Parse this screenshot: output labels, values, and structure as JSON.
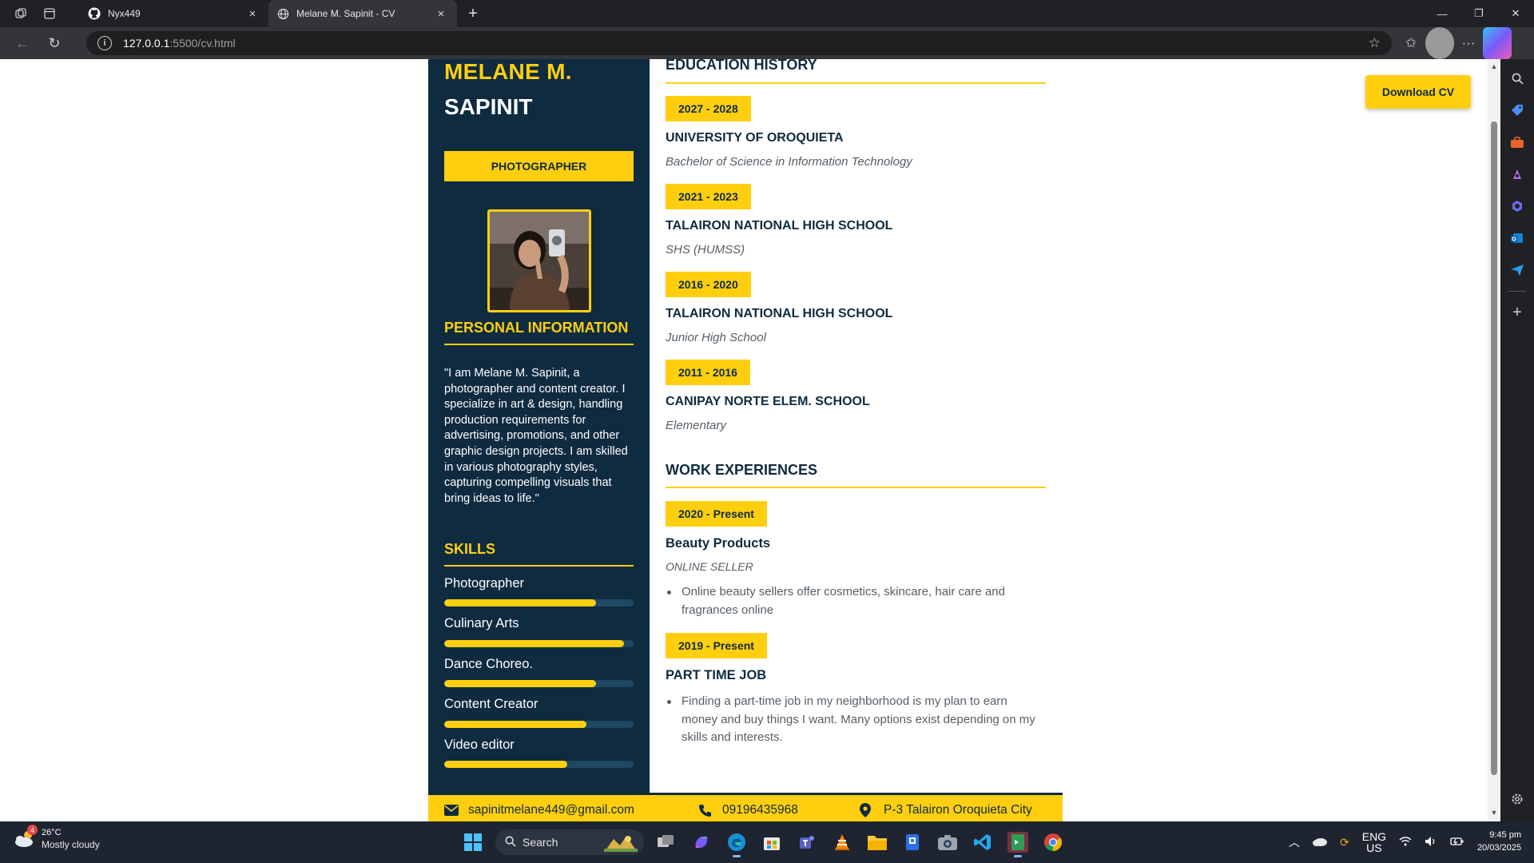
{
  "browser": {
    "tabs": [
      {
        "title": "Nyx449",
        "icon": "github-icon"
      },
      {
        "title": "Melane M. Sapinit - CV",
        "icon": "globe-icon",
        "active": true
      }
    ],
    "url_host": "127.0.0.1",
    "url_rest": ":5500/cv.html"
  },
  "cv": {
    "first_name": "MELANE M.",
    "last_name": "SAPINIT",
    "role": "PHOTOGRAPHER",
    "personal_heading": "PERSONAL INFORMATION",
    "about": "\"I am Melane M. Sapinit, a photographer and content creator. I specialize in art & design, handling production requirements for advertising, promotions, and other graphic design projects. I am skilled in various photography styles, capturing compelling visuals that bring ideas to life.\"",
    "skills_heading": "SKILLS",
    "skills": [
      {
        "label": "Photographer",
        "level": 0.8
      },
      {
        "label": "Culinary Arts",
        "level": 0.95
      },
      {
        "label": "Dance Choreo.",
        "level": 0.8
      },
      {
        "label": "Content Creator",
        "level": 0.75
      },
      {
        "label": "Video editor",
        "level": 0.65
      }
    ],
    "education_heading": "EDUCATION HISTORY",
    "education": [
      {
        "years": "2027 - 2028",
        "school": "UNIVERSITY OF OROQUIETA",
        "degree": "Bachelor of Science in Information Technology"
      },
      {
        "years": "2021 - 2023",
        "school": "TALAIRON NATIONAL HIGH SCHOOL",
        "degree": "SHS (HUMSS)"
      },
      {
        "years": "2016 - 2020",
        "school": "TALAIRON NATIONAL HIGH SCHOOL",
        "degree": "Junior High School"
      },
      {
        "years": "2011 - 2016",
        "school": "CANIPAY NORTE ELEM. SCHOOL",
        "degree": "Elementary"
      }
    ],
    "work_heading": "WORK EXPERIENCES",
    "work": [
      {
        "years": "2020 - Present",
        "title": "Beauty Products",
        "subtitle": "ONLINE SELLER",
        "bullet": "Online beauty sellers offer cosmetics, skincare, hair care and fragrances online"
      },
      {
        "years": "2019 - Present",
        "title": "PART TIME JOB",
        "subtitle": "",
        "bullet": "Finding a part-time job in my neighborhood is my plan to earn money and buy things I want. Many options exist depending on my skills and interests."
      }
    ],
    "contact": {
      "email": "sapinitmelane449@gmail.com",
      "phone": "09196435968",
      "address": "P-3 Talairon Oroquieta City"
    },
    "download_label": "Download CV"
  },
  "taskbar": {
    "weather_temp": "26°C",
    "weather_cond": "Mostly cloudy",
    "weather_badge": "4",
    "search_label": "Search",
    "lang1": "ENG",
    "lang2": "US",
    "time": "9:45 pm",
    "date": "20/03/2025"
  },
  "colors": {
    "navy": "#0f2b40",
    "yellow": "#ffcf0f"
  }
}
